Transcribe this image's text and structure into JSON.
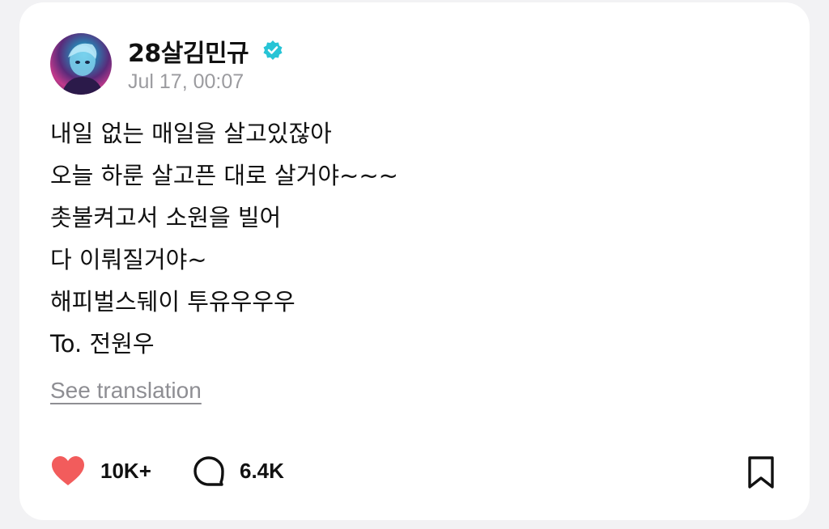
{
  "post": {
    "author": {
      "username": "28살김민규",
      "verified": true,
      "avatar_icon": "profile-photo"
    },
    "timestamp": "Jul 17, 00:07",
    "body_lines": [
      "내일 없는 매일을 살고있잖아",
      "오늘 하룬 살고픈 대로 살거야~~~",
      "촛불켜고서 소원을 빌어",
      "다 이뤄질거야~",
      "해피벌스뒈이 투유우우우",
      "To. 전원우"
    ],
    "see_translation": "See translation",
    "actions": {
      "like_count": "10K+",
      "comment_count": "6.4K",
      "like_icon": "heart-filled-icon",
      "comment_icon": "comment-bubble-icon",
      "bookmark_icon": "bookmark-icon"
    }
  },
  "colors": {
    "like": "#f25c5c",
    "verified": "#27c4d6",
    "muted": "#9b9b9f",
    "text": "#111111",
    "background": "#f2f2f4",
    "card": "#ffffff"
  }
}
